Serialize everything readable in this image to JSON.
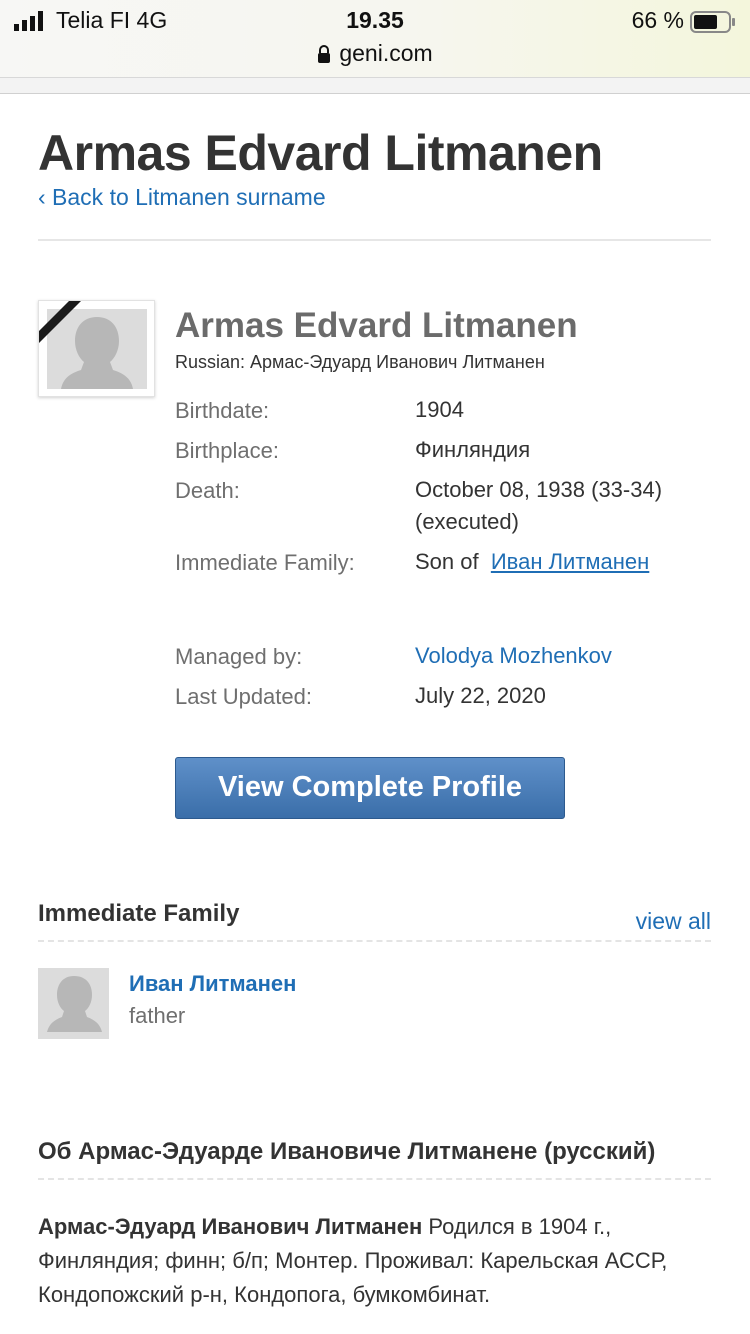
{
  "status_bar": {
    "carrier": "Telia FI   4G",
    "time": "19.35",
    "battery": "66 %"
  },
  "browser": {
    "url": "geni.com"
  },
  "page": {
    "title": "Armas Edvard Litmanen",
    "back_link": "‹ Back to Litmanen surname"
  },
  "profile": {
    "name": "Armas Edvard Litmanen",
    "alt_name": "Russian: Армас-Эдуард Иванович Литманен",
    "fields": {
      "birthdate_label": "Birthdate:",
      "birthdate": "1904",
      "birthplace_label": "Birthplace:",
      "birthplace": "Финляндия",
      "death_label": "Death:",
      "death_line1": "October 08, 1938 (33-34)",
      "death_line2": "(executed)",
      "family_label": "Immediate Family:",
      "family_prefix": "Son of",
      "family_link": "Иван Литманен",
      "managed_label": "Managed by:",
      "managed_by": "Volodya Mozhenkov",
      "updated_label": "Last Updated:",
      "updated": "July 22, 2020"
    },
    "view_button": "View Complete Profile"
  },
  "immediate_family": {
    "title": "Immediate Family",
    "view_all": "view all",
    "members": [
      {
        "name": "Иван Литманен",
        "relation": "father"
      }
    ]
  },
  "about": {
    "title": "Об Армас-Эдуарде Ивановиче Литманене (русский)",
    "bold_lead": "Армас-Эдуард Иванович Литманен",
    "text": " Родился в 1904 г., Финляндия; финн; б/п; Монтер. Проживал: Карельская АССР, Кондопожский р-н, Кондопога, бумкомбинат."
  },
  "colors": {
    "link": "#1f6eb5",
    "button": "#4a7fbc"
  }
}
